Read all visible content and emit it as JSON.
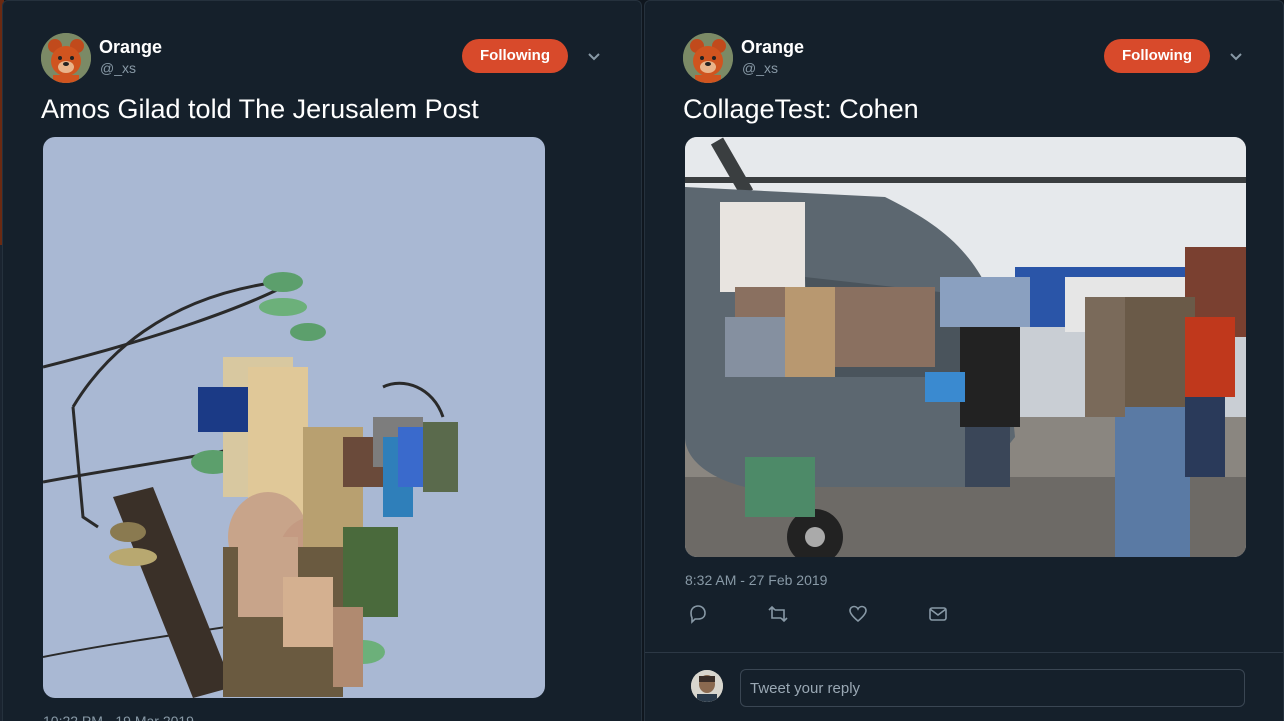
{
  "tweets": [
    {
      "author": {
        "name": "Orange",
        "handle": "@_xs",
        "avatar_icon": "bear-avatar-icon"
      },
      "follow_label": "Following",
      "text": "Amos Gilad told The Jerusalem Post",
      "timestamp": "10:22 PM - 19 Mar 2019",
      "media_icon": "collage-image-icon"
    },
    {
      "author": {
        "name": "Orange",
        "handle": "@_xs",
        "avatar_icon": "bear-avatar-icon"
      },
      "follow_label": "Following",
      "text": "CollageTest: Cohen",
      "timestamp": "8:32 AM - 27 Feb 2019",
      "media_icon": "helicopter-collage-image-icon",
      "actions": [
        "reply-icon",
        "retweet-icon",
        "like-icon",
        "message-icon"
      ],
      "reply": {
        "placeholder": "Tweet your reply",
        "avatar_icon": "user-avatar-icon"
      }
    }
  ],
  "colors": {
    "background": "#15202b",
    "follow_button": "#d84a2b",
    "muted_text": "#8899a6"
  }
}
